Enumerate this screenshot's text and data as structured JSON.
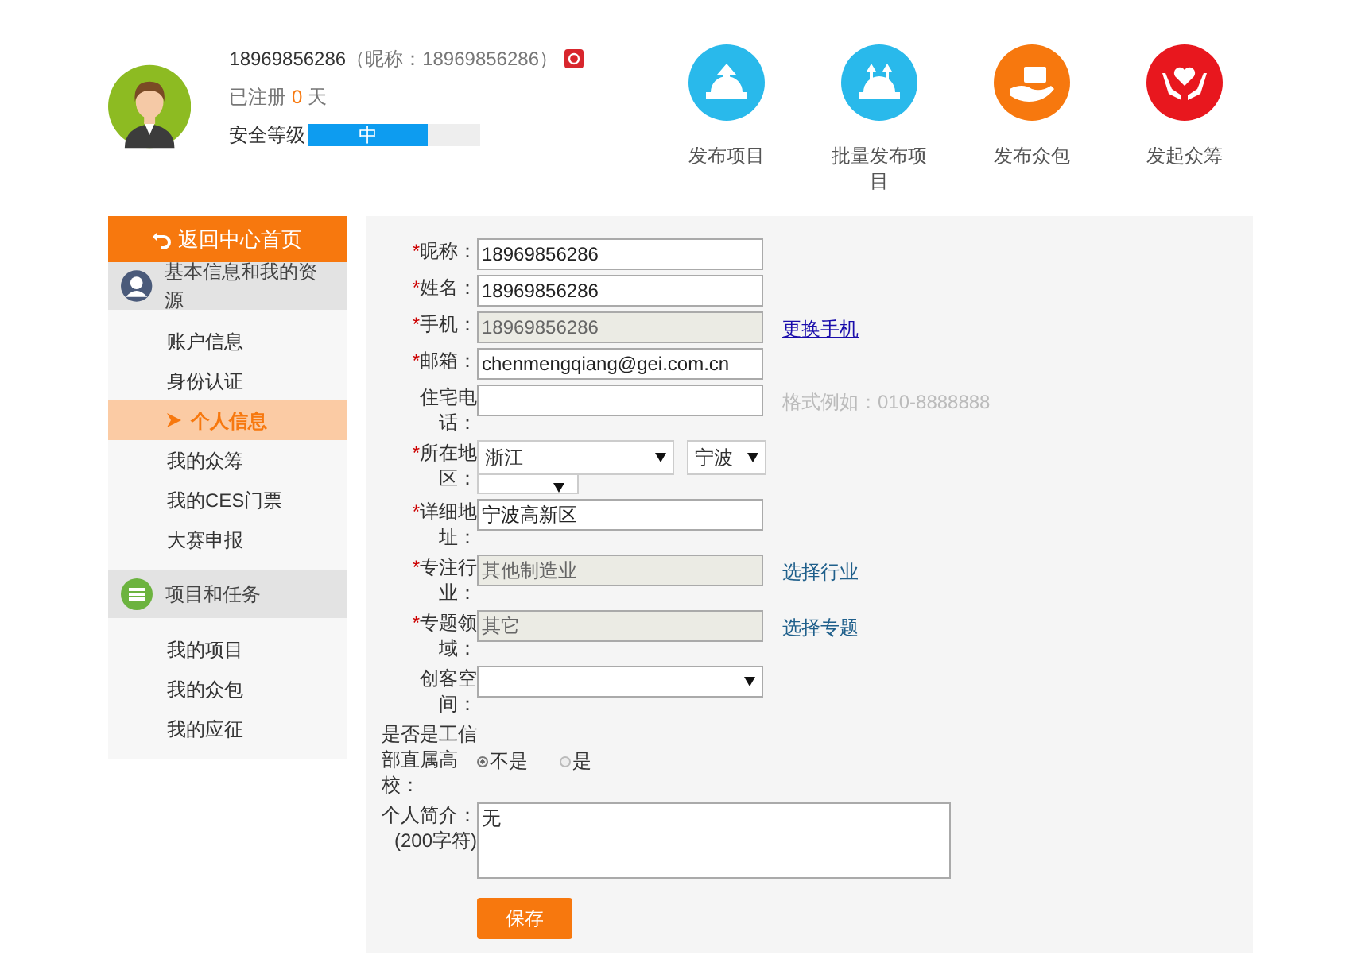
{
  "profile": {
    "account": "18969856286",
    "nickname_note": "（昵称：18969856286）",
    "registered_prefix": "已注册",
    "registered_days": "0",
    "registered_suffix": "天",
    "security_label": "安全等级",
    "security": {
      "text": "中",
      "level": 0.69
    }
  },
  "actions": [
    {
      "label": "发布项目",
      "color": "#29b9eb",
      "kind": "upload"
    },
    {
      "label": "批量发布项目",
      "color": "#29b9eb",
      "kind": "batch"
    },
    {
      "label": "发布众包",
      "color": "#f7780e",
      "kind": "package"
    },
    {
      "label": "发起众筹",
      "color": "#e8171e",
      "kind": "heart"
    }
  ],
  "sidebar": {
    "back": "返回中心首页",
    "sections": [
      {
        "title": "基本信息和我的资源",
        "kind": "person",
        "items": [
          {
            "label": "账户信息",
            "selected": false
          },
          {
            "label": "身份认证",
            "selected": false
          },
          {
            "label": "个人信息",
            "selected": true
          },
          {
            "label": "我的众筹",
            "selected": false
          },
          {
            "label": "我的CES门票",
            "selected": false
          },
          {
            "label": "大赛申报",
            "selected": false
          }
        ]
      },
      {
        "title": "项目和任务",
        "kind": "list",
        "items": [
          {
            "label": "我的项目",
            "selected": false
          },
          {
            "label": "我的众包",
            "selected": false
          },
          {
            "label": "我的应征",
            "selected": false
          }
        ]
      }
    ]
  },
  "form": {
    "rows": [
      {
        "kind": "text",
        "required_mark": "*",
        "label": "昵称：",
        "value": "18969856286"
      },
      {
        "kind": "text",
        "required_mark": "*",
        "label": "姓名：",
        "value": "18969856286"
      },
      {
        "kind": "readonly",
        "required_mark": "*",
        "label": "手机：",
        "value": "18969856286",
        "link": "更换手机"
      },
      {
        "kind": "text",
        "required_mark": "*",
        "label": "邮箱：",
        "value": "chenmengqiang@gei.com.cn"
      },
      {
        "kind": "text",
        "label": "住宅电话：",
        "value": "",
        "hint": "格式例如：010-8888888"
      },
      {
        "kind": "region",
        "required_mark": "*",
        "label": "所在地区：",
        "value": "浙江",
        "value2": "宁波"
      },
      {
        "kind": "text",
        "required_mark": "*",
        "label": "详细地址：",
        "value": "宁波高新区"
      },
      {
        "kind": "readonly",
        "required_mark": "*",
        "label": "专注行业：",
        "value": "其他制造业",
        "link": "选择行业"
      },
      {
        "kind": "readonly",
        "required_mark": "*",
        "label": "专题领域：",
        "value": "其它",
        "link": "选择专题"
      },
      {
        "kind": "select",
        "label": "创客空间：",
        "value": ""
      },
      {
        "kind": "radio",
        "label": "是否是工信部直属高校：",
        "options": [
          {
            "label": "不是",
            "selected": true
          },
          {
            "label": "是",
            "selected": false
          }
        ]
      },
      {
        "kind": "textarea",
        "label": "个人简介：(200字符)",
        "value": "无"
      }
    ],
    "save": "保存"
  }
}
